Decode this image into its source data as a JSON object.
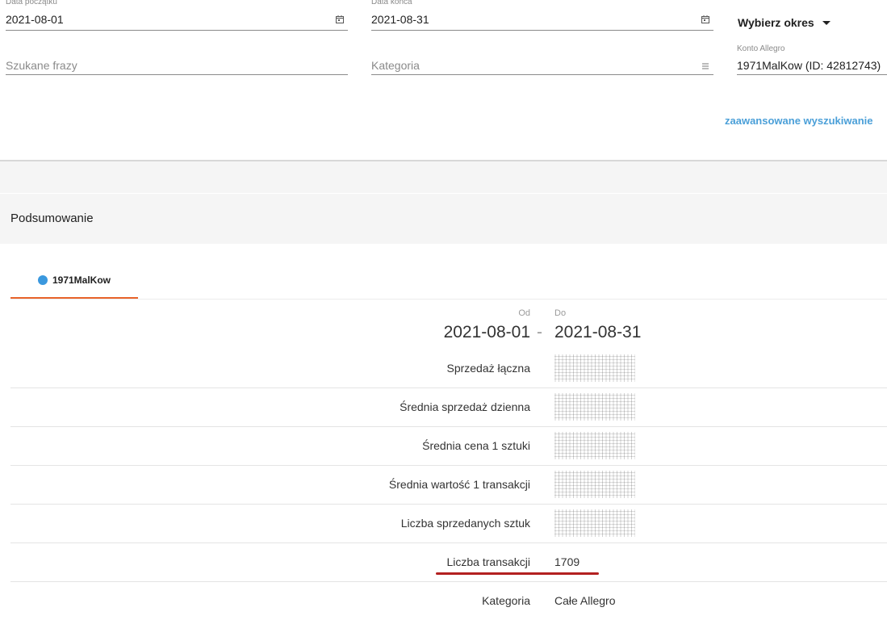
{
  "filters": {
    "start_date": {
      "label": "Data początku",
      "value": "2021-08-01"
    },
    "end_date": {
      "label": "Data końca",
      "value": "2021-08-31"
    },
    "period_button": "Wybierz okres",
    "phrases": {
      "placeholder": "Szukane frazy"
    },
    "category": {
      "placeholder": "Kategoria"
    },
    "account": {
      "label": "Konto Allegro",
      "value": "1971MalKow (ID: 42812743)"
    },
    "advanced_link": "zaawansowane wyszukiwanie"
  },
  "summary": {
    "title": "Podsumowanie",
    "tab_label": "1971MalKow",
    "tab_color": "#3a98de",
    "accent_color": "#e8632a",
    "header": {
      "from_label": "Od",
      "to_label": "Do",
      "from": "2021-08-01",
      "separator": "-",
      "to": "2021-08-31"
    },
    "rows": [
      {
        "label": "Sprzedaż łączna",
        "value": null
      },
      {
        "label": "Średnia sprzedaż dzienna",
        "value": null
      },
      {
        "label": "Średnia cena 1 sztuki",
        "value": null
      },
      {
        "label": "Średnia wartość 1 transakcji",
        "value": null
      },
      {
        "label": "Liczba sprzedanych sztuk",
        "value": null
      },
      {
        "label": "Liczba transakcji",
        "value": "1709"
      },
      {
        "label": "Kategoria",
        "value": "Całe Allegro"
      }
    ]
  }
}
